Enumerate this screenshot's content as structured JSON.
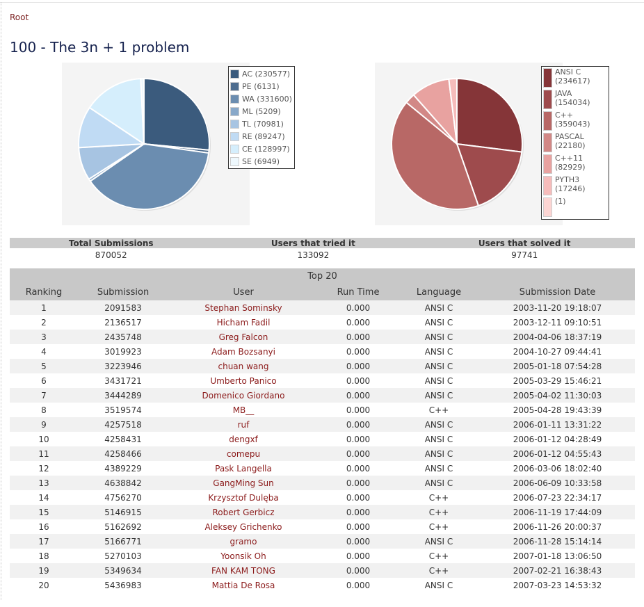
{
  "breadcrumb": {
    "root": "Root"
  },
  "title": "100 - The 3n + 1 problem",
  "chart_data": [
    {
      "type": "pie",
      "labels": [
        "AC (230577)",
        "PE (6131)",
        "WA (331600)",
        "ML (5209)",
        "TL (70981)",
        "RE (89247)",
        "CE (128997)",
        "SE (6949)"
      ],
      "values": [
        230577,
        6131,
        331600,
        5209,
        70981,
        89247,
        128997,
        6949
      ],
      "colors": [
        "#3b5b7d",
        "#4d6c8e",
        "#6b8db0",
        "#88a8c9",
        "#a7c4e2",
        "#c0dbf4",
        "#d5eefc",
        "#eef8fd"
      ]
    },
    {
      "type": "pie",
      "labels": [
        "ANSI C\n(234617)",
        "JAVA\n(154034)",
        "C++\n(359043)",
        "PASCAL\n(22180)",
        "C++11\n(82929)",
        "PYTH3\n(17246)",
        "(1)"
      ],
      "values": [
        234617,
        154034,
        359043,
        22180,
        82929,
        17246,
        1
      ],
      "colors": [
        "#853538",
        "#9e4b4d",
        "#b86866",
        "#d28886",
        "#e8a2a0",
        "#f6bcbb",
        "#fcd5d3"
      ]
    }
  ],
  "stats": {
    "headers": [
      "Total Submissions",
      "Users that tried it",
      "Users that solved it"
    ],
    "values": [
      "870052",
      "133092",
      "97741"
    ]
  },
  "top": {
    "caption": "Top 20",
    "headers": [
      "Ranking",
      "Submission",
      "User",
      "Run Time",
      "Language",
      "Submission Date"
    ],
    "rows": [
      [
        "1",
        "2091583",
        "Stephan Sominsky",
        "0.000",
        "ANSI C",
        "2003-11-20 19:18:07"
      ],
      [
        "2",
        "2136517",
        "Hicham Fadil",
        "0.000",
        "ANSI C",
        "2003-12-11 09:10:51"
      ],
      [
        "3",
        "2435748",
        "Greg Falcon",
        "0.000",
        "ANSI C",
        "2004-04-06 18:37:19"
      ],
      [
        "4",
        "3019923",
        "Adam Bozsanyi",
        "0.000",
        "ANSI C",
        "2004-10-27 09:44:41"
      ],
      [
        "5",
        "3223946",
        "chuan wang",
        "0.000",
        "ANSI C",
        "2005-01-18 07:54:28"
      ],
      [
        "6",
        "3431721",
        "Umberto Panico",
        "0.000",
        "ANSI C",
        "2005-03-29 15:46:21"
      ],
      [
        "7",
        "3444289",
        "Domenico Giordano",
        "0.000",
        "ANSI C",
        "2005-04-02 11:30:03"
      ],
      [
        "8",
        "3519574",
        "MB__",
        "0.000",
        "C++",
        "2005-04-28 19:43:39"
      ],
      [
        "9",
        "4257518",
        "ruf",
        "0.000",
        "ANSI C",
        "2006-01-11 13:31:22"
      ],
      [
        "10",
        "4258431",
        "dengxf",
        "0.000",
        "ANSI C",
        "2006-01-12 04:28:49"
      ],
      [
        "11",
        "4258466",
        "comepu",
        "0.000",
        "ANSI C",
        "2006-01-12 04:55:43"
      ],
      [
        "12",
        "4389229",
        "Pask Langella",
        "0.000",
        "ANSI C",
        "2006-03-06 18:02:40"
      ],
      [
        "13",
        "4638842",
        "GangMing Sun",
        "0.000",
        "ANSI C",
        "2006-06-09 10:33:58"
      ],
      [
        "14",
        "4756270",
        "Krzysztof Dulęba",
        "0.000",
        "C++",
        "2006-07-23 22:34:17"
      ],
      [
        "15",
        "5146915",
        "Robert Gerbicz",
        "0.000",
        "C++",
        "2006-11-19 17:44:09"
      ],
      [
        "16",
        "5162692",
        "Aleksey Grichenko",
        "0.000",
        "C++",
        "2006-11-26 20:00:37"
      ],
      [
        "17",
        "5166771",
        "gramo",
        "0.000",
        "ANSI C",
        "2006-11-28 15:14:14"
      ],
      [
        "18",
        "5270103",
        "Yoonsik Oh",
        "0.000",
        "C++",
        "2007-01-18 13:06:50"
      ],
      [
        "19",
        "5349634",
        "FAN KAM TONG",
        "0.000",
        "C++",
        "2007-02-21 16:38:43"
      ],
      [
        "20",
        "5436983",
        "Mattia De Rosa",
        "0.000",
        "ANSI C",
        "2007-03-23 14:53:32"
      ]
    ]
  }
}
